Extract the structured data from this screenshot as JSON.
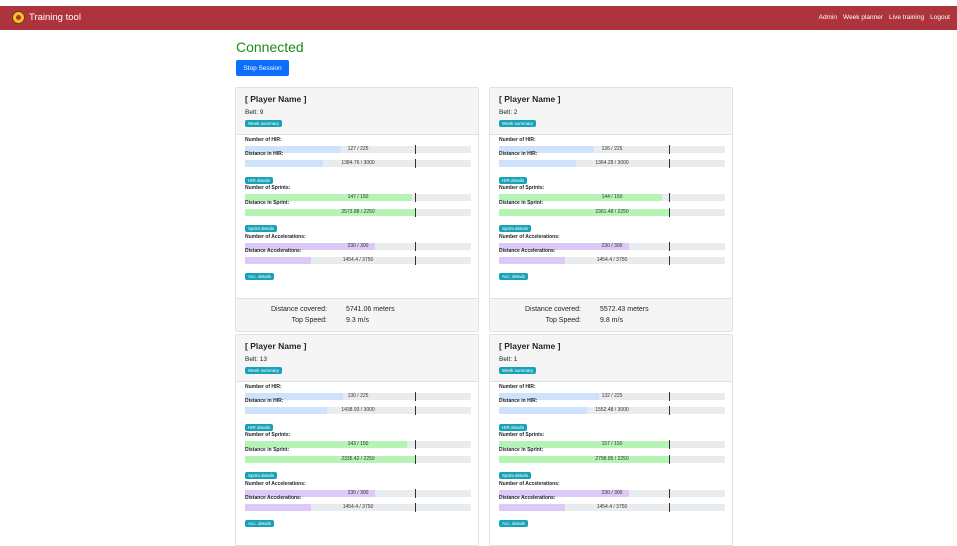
{
  "nav": {
    "brand": "Training tool",
    "links": [
      "Admin",
      "Week planner",
      "Live training",
      "Logout"
    ]
  },
  "status": "Connected",
  "stop_button": "Stop Session",
  "labels": {
    "week_summary": "Week summary",
    "hir_count": "Number of HIR:",
    "hir_distance": "Distance in HIR:",
    "hir_details": "HIR details",
    "sprint_count": "Number of Sprints:",
    "sprint_distance": "Distance in Sprint:",
    "sprint_details": "Sprint details",
    "acc_count": "Number of Accelerations:",
    "acc_distance": "Distance Accelerations:",
    "acc_details": "Acc. details",
    "distance_covered": "Distance covered:",
    "top_speed": "Top Speed:"
  },
  "colors": {
    "hir": "#cfe2fb",
    "sprint": "#b6f4b6",
    "acc": "#dcc9f7"
  },
  "players": [
    {
      "name": "[ Player Name ]",
      "belt": "Belt: 9",
      "hir_count": {
        "text": "127 / 225",
        "value": 127,
        "max": 225
      },
      "hir_distance": {
        "text": "1384.76 / 3000",
        "value": 1384.76,
        "max": 3000
      },
      "sprint_count": {
        "text": "147 / 150",
        "value": 147,
        "max": 150
      },
      "sprint_distance": {
        "text": "2573.88 / 2250",
        "value": 2573.88,
        "max": 2250
      },
      "acc_count": {
        "text": "230 / 300",
        "value": 230,
        "max": 300
      },
      "acc_distance": {
        "text": "1454.4 / 3750",
        "value": 1454.4,
        "max": 3750
      },
      "distance_covered": "5741.06 meters",
      "top_speed": "9.3 m/s"
    },
    {
      "name": "[ Player Name ]",
      "belt": "Belt: 2",
      "hir_count": {
        "text": "126 / 225",
        "value": 126,
        "max": 225
      },
      "hir_distance": {
        "text": "1364.28 / 3000",
        "value": 1364.28,
        "max": 3000
      },
      "sprint_count": {
        "text": "144 / 150",
        "value": 144,
        "max": 150
      },
      "sprint_distance": {
        "text": "2361.48 / 2250",
        "value": 2361.48,
        "max": 2250
      },
      "acc_count": {
        "text": "230 / 300",
        "value": 230,
        "max": 300
      },
      "acc_distance": {
        "text": "1454.4 / 3750",
        "value": 1454.4,
        "max": 3750
      },
      "distance_covered": "5572.43 meters",
      "top_speed": "9.8 m/s"
    },
    {
      "name": "[ Player Name ]",
      "belt": "Belt: 13",
      "hir_count": {
        "text": "130 / 225",
        "value": 130,
        "max": 225
      },
      "hir_distance": {
        "text": "1438.93 / 3000",
        "value": 1438.93,
        "max": 3000
      },
      "sprint_count": {
        "text": "143 / 150",
        "value": 143,
        "max": 150
      },
      "sprint_distance": {
        "text": "2335.42 / 2250",
        "value": 2335.42,
        "max": 2250
      },
      "acc_count": {
        "text": "230 / 300",
        "value": 230,
        "max": 300
      },
      "acc_distance": {
        "text": "1454.4 / 3750",
        "value": 1454.4,
        "max": 3750
      }
    },
    {
      "name": "[ Player Name ]",
      "belt": "Belt: 1",
      "hir_count": {
        "text": "132 / 225",
        "value": 132,
        "max": 225
      },
      "hir_distance": {
        "text": "1552.48 / 3000",
        "value": 1552.48,
        "max": 3000
      },
      "sprint_count": {
        "text": "157 / 150",
        "value": 157,
        "max": 150
      },
      "sprint_distance": {
        "text": "2798.85 / 2250",
        "value": 2798.85,
        "max": 2250
      },
      "acc_count": {
        "text": "230 / 300",
        "value": 230,
        "max": 300
      },
      "acc_distance": {
        "text": "1454.4 / 3750",
        "value": 1454.4,
        "max": 3750
      }
    }
  ]
}
